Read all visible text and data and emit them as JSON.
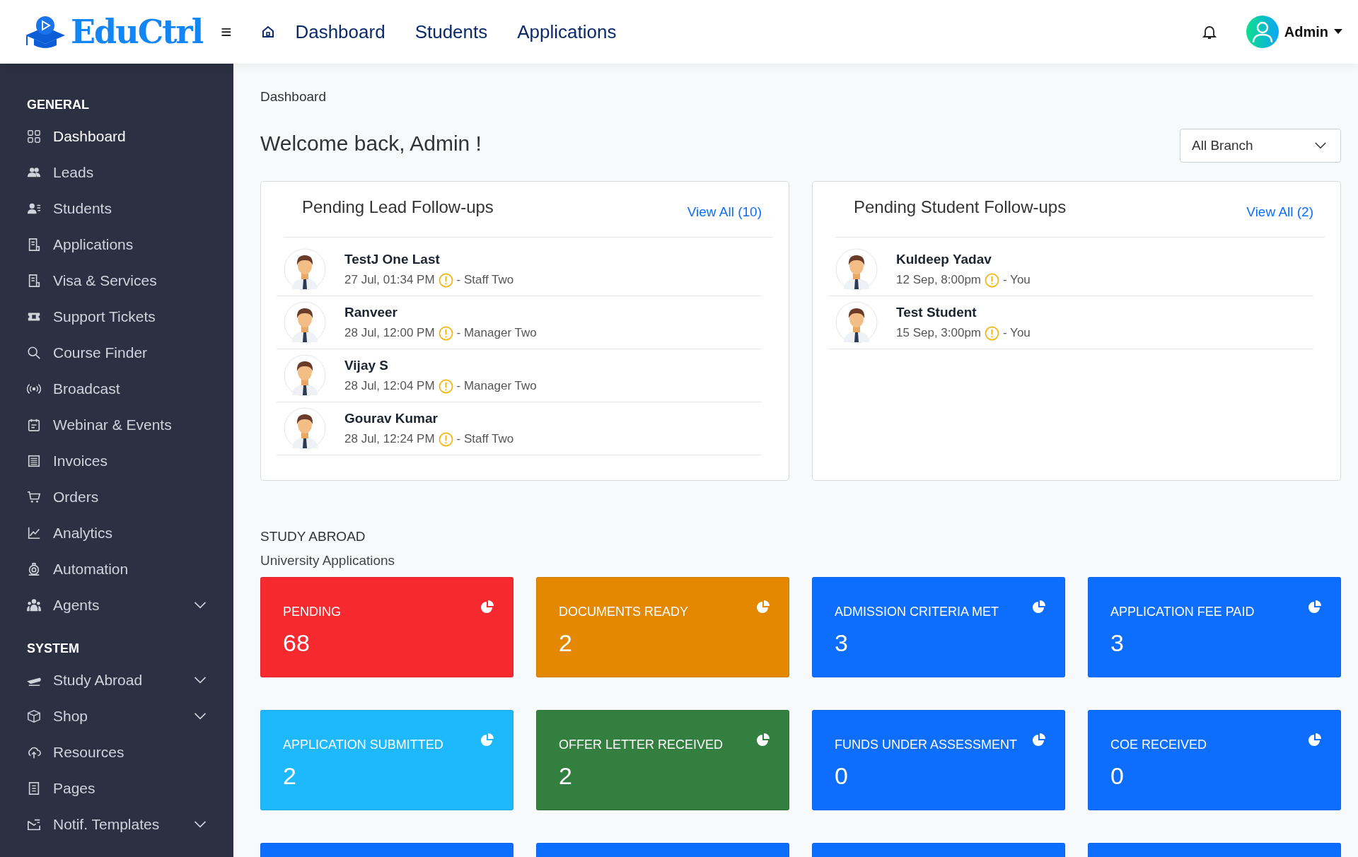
{
  "header": {
    "logo": "EduCtrl",
    "menu_glyph": "≡",
    "nav": [
      {
        "label": "Dashboard"
      },
      {
        "label": "Students"
      },
      {
        "label": "Applications"
      }
    ],
    "user": "Admin"
  },
  "sidebar": {
    "sections": [
      {
        "title": "GENERAL",
        "items": [
          {
            "label": "Dashboard",
            "selected": true,
            "expandable": false
          },
          {
            "label": "Leads",
            "selected": false,
            "expandable": false
          },
          {
            "label": "Students",
            "selected": false,
            "expandable": false
          },
          {
            "label": "Applications",
            "selected": false,
            "expandable": false
          },
          {
            "label": "Visa & Services",
            "selected": false,
            "expandable": false
          },
          {
            "label": "Support Tickets",
            "selected": false,
            "expandable": false
          },
          {
            "label": "Course Finder",
            "selected": false,
            "expandable": false
          },
          {
            "label": "Broadcast",
            "selected": false,
            "expandable": false
          },
          {
            "label": "Webinar & Events",
            "selected": false,
            "expandable": false
          },
          {
            "label": "Invoices",
            "selected": false,
            "expandable": false
          },
          {
            "label": "Orders",
            "selected": false,
            "expandable": false
          },
          {
            "label": "Analytics",
            "selected": false,
            "expandable": false
          },
          {
            "label": "Automation",
            "selected": false,
            "expandable": false
          },
          {
            "label": "Agents",
            "selected": false,
            "expandable": true
          }
        ]
      },
      {
        "title": "SYSTEM",
        "items": [
          {
            "label": "Study Abroad",
            "selected": false,
            "expandable": true
          },
          {
            "label": "Shop",
            "selected": false,
            "expandable": true
          },
          {
            "label": "Resources",
            "selected": false,
            "expandable": false
          },
          {
            "label": "Pages",
            "selected": false,
            "expandable": false
          },
          {
            "label": "Notif. Templates",
            "selected": false,
            "expandable": true
          }
        ]
      }
    ]
  },
  "breadcrumb": "Dashboard",
  "welcome": "Welcome back, Admin !",
  "branch_select": {
    "value": "All Branch"
  },
  "followups": [
    {
      "title": "Pending Lead Follow-ups",
      "link": "View All (10)",
      "rows": [
        {
          "name": "TestJ One Last",
          "time": "27 Jul, 01:34 PM",
          "by": "- Staff Two"
        },
        {
          "name": "Ranveer",
          "time": "28 Jul, 12:00 PM",
          "by": "- Manager Two"
        },
        {
          "name": "Vijay S",
          "time": "28 Jul, 12:04 PM",
          "by": "- Manager Two"
        },
        {
          "name": "Gourav Kumar",
          "time": "28 Jul, 12:24 PM",
          "by": "- Staff Two"
        }
      ]
    },
    {
      "title": "Pending Student Follow-ups",
      "link": "View All (2)",
      "rows": [
        {
          "name": "Kuldeep Yadav",
          "time": "12 Sep, 8:00pm",
          "by": "- You"
        },
        {
          "name": "Test Student",
          "time": "15 Sep, 3:00pm",
          "by": "- You"
        }
      ]
    }
  ],
  "section_title": "STUDY ABROAD",
  "section_subtitle": "University Applications",
  "stat_cards": [
    {
      "label": "PENDING",
      "value": "68",
      "color": "#f5292e"
    },
    {
      "label": "DOCUMENTS READY",
      "value": "2",
      "color": "#e38800"
    },
    {
      "label": "ADMISSION CRITERIA MET",
      "value": "3",
      "color": "#0d6efd"
    },
    {
      "label": "APPLICATION FEE PAID",
      "value": "3",
      "color": "#0d6efd"
    },
    {
      "label": "APPLICATION SUBMITTED",
      "value": "2",
      "color": "#1eb9fc"
    },
    {
      "label": "OFFER LETTER RECEIVED",
      "value": "2",
      "color": "#337f3f"
    },
    {
      "label": "FUNDS UNDER ASSESSMENT",
      "value": "0",
      "color": "#0d6efd"
    },
    {
      "label": "COE RECEIVED",
      "value": "0",
      "color": "#0d6efd"
    }
  ],
  "partial_cards": [
    {
      "color": "#0d6efd"
    },
    {
      "color": "#0d6efd"
    },
    {
      "color": "#0d6efd"
    },
    {
      "color": "#0d6efd"
    }
  ]
}
